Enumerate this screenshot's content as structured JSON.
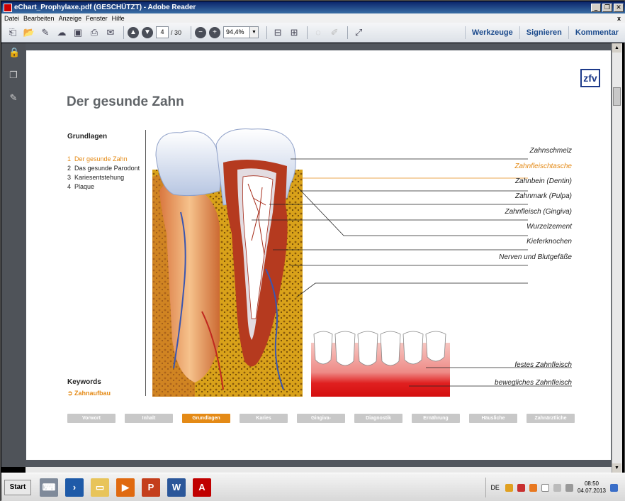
{
  "window": {
    "title": "eChart_Prophylaxe.pdf (GESCHÜTZT) - Adobe Reader",
    "minimize": "_",
    "restore": "❐",
    "close": "✕"
  },
  "menubar": {
    "items": [
      "Datei",
      "Bearbeiten",
      "Anzeige",
      "Fenster",
      "Hilfe"
    ],
    "close_doc": "x"
  },
  "toolbar": {
    "page_current": "4",
    "page_total": "/ 30",
    "zoom": "94,4%",
    "links": [
      "Werkzeuge",
      "Signieren",
      "Kommentar"
    ]
  },
  "page": {
    "logo": "zfv",
    "title": "Der gesunde Zahn",
    "section": "Grundlagen",
    "toc": [
      {
        "num": "1",
        "label": "Der gesunde Zahn",
        "active": true
      },
      {
        "num": "2",
        "label": "Das gesunde Parodont",
        "active": false
      },
      {
        "num": "3",
        "label": "Kariesentstehung",
        "active": false
      },
      {
        "num": "4",
        "label": "Plaque",
        "active": false
      }
    ],
    "keywords_head": "Keywords",
    "keyword_link": "➲ Zahnaufbau",
    "tooth_labels": [
      "Zahnschmelz",
      "Zahnfleischtasche",
      "Zahnbein (Dentin)",
      "Zahnmark (Pulpa)",
      "Zahnfleisch (Gingiva)",
      "Wurzelzement",
      "Kieferknochen",
      "Nerven und Blutgefäße"
    ],
    "gum_labels": [
      "festes Zahnfleisch",
      "bewegliches Zahnfleisch"
    ],
    "navtabs": [
      {
        "label": "Vorwort",
        "active": false
      },
      {
        "label": "Inhalt",
        "active": false
      },
      {
        "label": "Grundlagen",
        "active": true
      },
      {
        "label": "Karies",
        "active": false
      },
      {
        "label": "Gingiva-Erkrankungen",
        "active": false
      },
      {
        "label": "Diagnostik",
        "active": false
      },
      {
        "label": "Ernährung",
        "active": false
      },
      {
        "label": "Häusliche Zahnpflege",
        "active": false
      },
      {
        "label": "Zahnärztliche Vorsorge",
        "active": false
      }
    ],
    "accent_color": "#e48a16"
  },
  "taskbar": {
    "start": "Start",
    "lang": "DE",
    "time": "08:50",
    "date": "04.07.2013"
  }
}
